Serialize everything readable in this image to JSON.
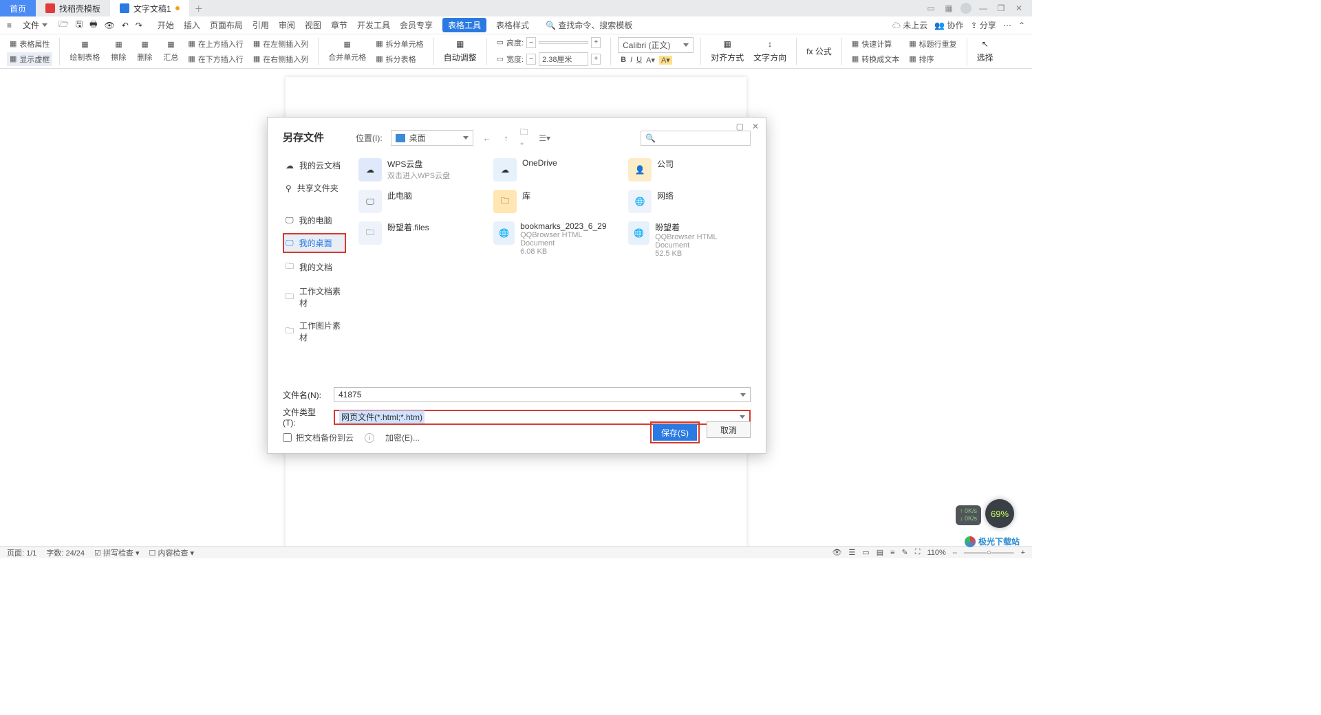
{
  "tabs": {
    "home": "首页",
    "template": "找稻壳模板",
    "doc": "文字文稿1"
  },
  "menubar": {
    "file": "文件",
    "items": [
      "开始",
      "插入",
      "页面布局",
      "引用",
      "审阅",
      "视图",
      "章节",
      "开发工具",
      "会员专享"
    ],
    "activeTool": "表格工具",
    "styleLink": "表格样式",
    "searchPh": "查找命令、搜索模板",
    "cloud": "未上云",
    "coop": "协作",
    "share": "分享"
  },
  "ribbon": {
    "tableProp": "表格属性",
    "showGrid": "显示虚框",
    "drawTable": "绘制表格",
    "erase": "擦除",
    "delete": "删除",
    "merge": "汇总",
    "insTop": "在上方插入行",
    "insBottom": "在下方插入行",
    "insLeft": "在左侧插入列",
    "insRight": "在右侧插入列",
    "mergeCell": "合并单元格",
    "splitCell": "拆分单元格",
    "splitTbl": "拆分表格",
    "autoFit": "自动调整",
    "height": "高度:",
    "width": "宽度:",
    "wVal": "2.38厘米",
    "font": "Calibri (正文)",
    "align": "对齐方式",
    "textDir": "文字方向",
    "fx": "fx 公式",
    "quickCalc": "快速计算",
    "titleRepeat": "标题行重复",
    "toText": "转换成文本",
    "sort": "排序",
    "select": "选择"
  },
  "dialog": {
    "title": "另存文件",
    "side": {
      "cloud": "我的云文档",
      "shared": "共享文件夹",
      "pc": "我的电脑",
      "desk": "我的桌面",
      "docs": "我的文档",
      "mat1": "工作文档素材",
      "mat2": "工作图片素材"
    },
    "toolbar": {
      "locLabel": "位置(I):",
      "locVal": "桌面"
    },
    "items": [
      {
        "name": "WPS云盘",
        "sub": "双击进入WPS云盘"
      },
      {
        "name": "OneDrive",
        "sub": ""
      },
      {
        "name": "公司",
        "sub": ""
      },
      {
        "name": "此电脑",
        "sub": ""
      },
      {
        "name": "库",
        "sub": ""
      },
      {
        "name": "网络",
        "sub": ""
      },
      {
        "name": "盼望着.files",
        "sub": ""
      },
      {
        "name": "bookmarks_2023_6_29",
        "sub": "QQBrowser HTML Document",
        "size": "6.08 KB"
      },
      {
        "name": "盼望着",
        "sub": "QQBrowser HTML Document",
        "size": "52.5 KB"
      }
    ],
    "fnameLabel": "文件名(N):",
    "fname": "41875",
    "ftypeLabel": "文件类型(T):",
    "ftype": "网页文件(*.html;*.htm)",
    "backup": "把文档备份到云",
    "encrypt": "加密(E)...",
    "save": "保存(S)",
    "cancel": "取消"
  },
  "status": {
    "page": "页面: 1/1",
    "words": "字数: 24/24",
    "spell": "拼写检查",
    "content": "内容检查",
    "zoom": "110%"
  },
  "extras": {
    "bubble": "69%",
    "sUp": "0K/s",
    "sDn": "0K/s",
    "wm": "极光下载站"
  }
}
